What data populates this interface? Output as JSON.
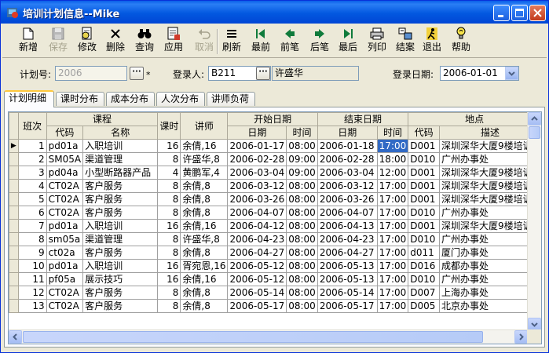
{
  "window": {
    "title": "培训计划信息--Mike"
  },
  "toolbar": {
    "items": [
      {
        "label": "新增",
        "icon": "new-document-icon",
        "enabled": true
      },
      {
        "label": "保存",
        "icon": "save-disk-icon",
        "enabled": false
      },
      {
        "label": "修改",
        "icon": "edit-document-icon",
        "enabled": true
      },
      {
        "label": "删除",
        "icon": "delete-x-icon",
        "enabled": true
      },
      {
        "label": "查询",
        "icon": "binoculars-icon",
        "enabled": true
      },
      {
        "label": "应用",
        "icon": "apply-document-icon",
        "enabled": true
      },
      {
        "label": "取消",
        "icon": "undo-arrow-icon",
        "enabled": false
      },
      {
        "label": "刷新",
        "icon": "refresh-lines-icon",
        "enabled": true
      },
      {
        "label": "最前",
        "icon": "first-record-icon",
        "enabled": true
      },
      {
        "label": "前笔",
        "icon": "previous-record-icon",
        "enabled": true
      },
      {
        "label": "后笔",
        "icon": "next-record-icon",
        "enabled": true
      },
      {
        "label": "最后",
        "icon": "last-record-icon",
        "enabled": true
      },
      {
        "label": "列印",
        "icon": "printer-icon",
        "enabled": true
      },
      {
        "label": "结案",
        "icon": "close-case-icon",
        "enabled": true
      },
      {
        "label": "退出",
        "icon": "exit-running-man-icon",
        "enabled": true
      },
      {
        "label": "帮助",
        "icon": "help-bulb-icon",
        "enabled": true
      }
    ]
  },
  "form": {
    "plan_no_label": "计划号:",
    "plan_no_value": "2006",
    "required_mark": "*",
    "ellipsis": "···",
    "registrant_label": "登录人:",
    "registrant_code": "B211",
    "registrant_name": "许盛华",
    "reg_date_label": "登录日期:",
    "reg_date_value": "2006-01-01"
  },
  "tabs": [
    "计划明细",
    "课时分布",
    "成本分布",
    "人次分布",
    "讲师负荷"
  ],
  "grid": {
    "headers": {
      "class": "班次",
      "course": "课程",
      "code": "代码",
      "name": "名称",
      "hours": "课时",
      "lecturer": "讲师",
      "start": "开始日期",
      "end": "结束日期",
      "date": "日期",
      "time": "时间",
      "location": "地点",
      "loc_code": "代码",
      "loc_desc": "描述"
    },
    "rows": [
      {
        "no": "1",
        "code": "pd01a",
        "name": "入职培训",
        "hours": "16",
        "lecturer": "余倩,16",
        "sdate": "2006-01-17",
        "stime": "08:00",
        "edate": "2006-01-18",
        "etime": "17:00",
        "lcode": "D001",
        "ldesc": "深圳深华大厦9楼培训"
      },
      {
        "no": "2",
        "code": "SM05A",
        "name": "渠道管理",
        "hours": "8",
        "lecturer": "许盛华,8",
        "sdate": "2006-02-28",
        "stime": "09:00",
        "edate": "2006-02-28",
        "etime": "18:00",
        "lcode": "D010",
        "ldesc": "广州办事处"
      },
      {
        "no": "3",
        "code": "pd04a",
        "name": "小型断路器产品",
        "hours": "4",
        "lecturer": "黄鹏军,4",
        "sdate": "2006-03-04",
        "stime": "09:00",
        "edate": "2006-03-04",
        "etime": "12:00",
        "lcode": "D001",
        "ldesc": "深圳深华大厦9楼培训"
      },
      {
        "no": "4",
        "code": "CT02A",
        "name": "客户服务",
        "hours": "8",
        "lecturer": "余倩,8",
        "sdate": "2006-03-12",
        "stime": "08:00",
        "edate": "2006-03-12",
        "etime": "17:00",
        "lcode": "D001",
        "ldesc": "深圳深华大厦9楼培训"
      },
      {
        "no": "5",
        "code": "CT02A",
        "name": "客户服务",
        "hours": "8",
        "lecturer": "余倩,8",
        "sdate": "2006-03-26",
        "stime": "08:00",
        "edate": "2006-03-26",
        "etime": "17:00",
        "lcode": "D001",
        "ldesc": "深圳深华大厦9楼培训"
      },
      {
        "no": "6",
        "code": "CT02A",
        "name": "客户服务",
        "hours": "8",
        "lecturer": "余倩,8",
        "sdate": "2006-04-07",
        "stime": "08:00",
        "edate": "2006-04-07",
        "etime": "17:00",
        "lcode": "D010",
        "ldesc": "广州办事处"
      },
      {
        "no": "7",
        "code": "pd01a",
        "name": "入职培训",
        "hours": "16",
        "lecturer": "余倩,16",
        "sdate": "2006-04-12",
        "stime": "08:00",
        "edate": "2006-04-13",
        "etime": "17:00",
        "lcode": "D001",
        "ldesc": "深圳深华大厦9楼培训"
      },
      {
        "no": "8",
        "code": "sm05a",
        "name": "渠道管理",
        "hours": "8",
        "lecturer": "许盛华,8",
        "sdate": "2006-04-23",
        "stime": "08:00",
        "edate": "2006-04-23",
        "etime": "17:00",
        "lcode": "D010",
        "ldesc": "广州办事处"
      },
      {
        "no": "9",
        "code": "ct02a",
        "name": "客户服务",
        "hours": "8",
        "lecturer": "余倩,8",
        "sdate": "2006-04-27",
        "stime": "08:00",
        "edate": "2006-04-27",
        "etime": "17:00",
        "lcode": "d011",
        "ldesc": "厦门办事处"
      },
      {
        "no": "10",
        "code": "pd01a",
        "name": "入职培训",
        "hours": "16",
        "lecturer": "胥宛恩,16",
        "sdate": "2006-05-12",
        "stime": "08:00",
        "edate": "2006-05-13",
        "etime": "17:00",
        "lcode": "D016",
        "ldesc": "成都办事处"
      },
      {
        "no": "11",
        "code": "pf05a",
        "name": "展示技巧",
        "hours": "16",
        "lecturer": "余倩,16",
        "sdate": "2006-05-12",
        "stime": "08:00",
        "edate": "2006-05-13",
        "etime": "17:00",
        "lcode": "D010",
        "ldesc": "广州办事处"
      },
      {
        "no": "12",
        "code": "CT02A",
        "name": "客户服务",
        "hours": "8",
        "lecturer": "余倩,8",
        "sdate": "2006-05-14",
        "stime": "08:00",
        "edate": "2006-05-14",
        "etime": "17:00",
        "lcode": "D007",
        "ldesc": "上海办事处"
      },
      {
        "no": "13",
        "code": "CT02A",
        "name": "客户服务",
        "hours": "8",
        "lecturer": "余倩,8",
        "sdate": "2006-05-17",
        "stime": "08:00",
        "edate": "2006-05-17",
        "etime": "17:00",
        "lcode": "D005",
        "ldesc": "北京办事处"
      }
    ]
  }
}
